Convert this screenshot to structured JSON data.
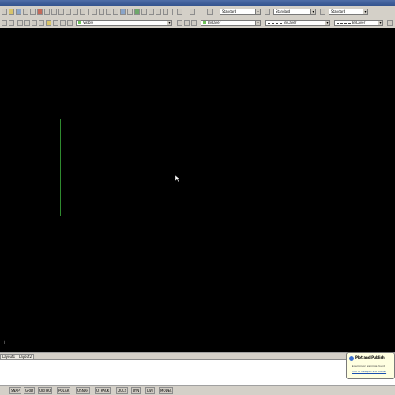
{
  "window": {
    "title": ""
  },
  "toolbar_top": {
    "text_style_combo": "Standard",
    "dim_style_combo": "Standard",
    "table_style_combo": "Standard"
  },
  "toolbar_layers": {
    "layer_combo": "Visible",
    "color_combo": "ByLayer",
    "linetype_combo": "ByLayer",
    "lineweight_combo": "ByLayer"
  },
  "layout_tabs": [
    "Layout1",
    "Layout2"
  ],
  "status_buttons": [
    "SNAP",
    "GRID",
    "ORTHO",
    "POLAR",
    "OSNAP",
    "OTRACK",
    "DUCS",
    "DYN",
    "LWT",
    "MODEL"
  ],
  "notification": {
    "title": "Plot and Publish",
    "line1": "No errors or warnings found",
    "line2": "Click to view plot and publish"
  },
  "colors": {
    "canvas": "#000000",
    "line": "#2f8a2f"
  }
}
